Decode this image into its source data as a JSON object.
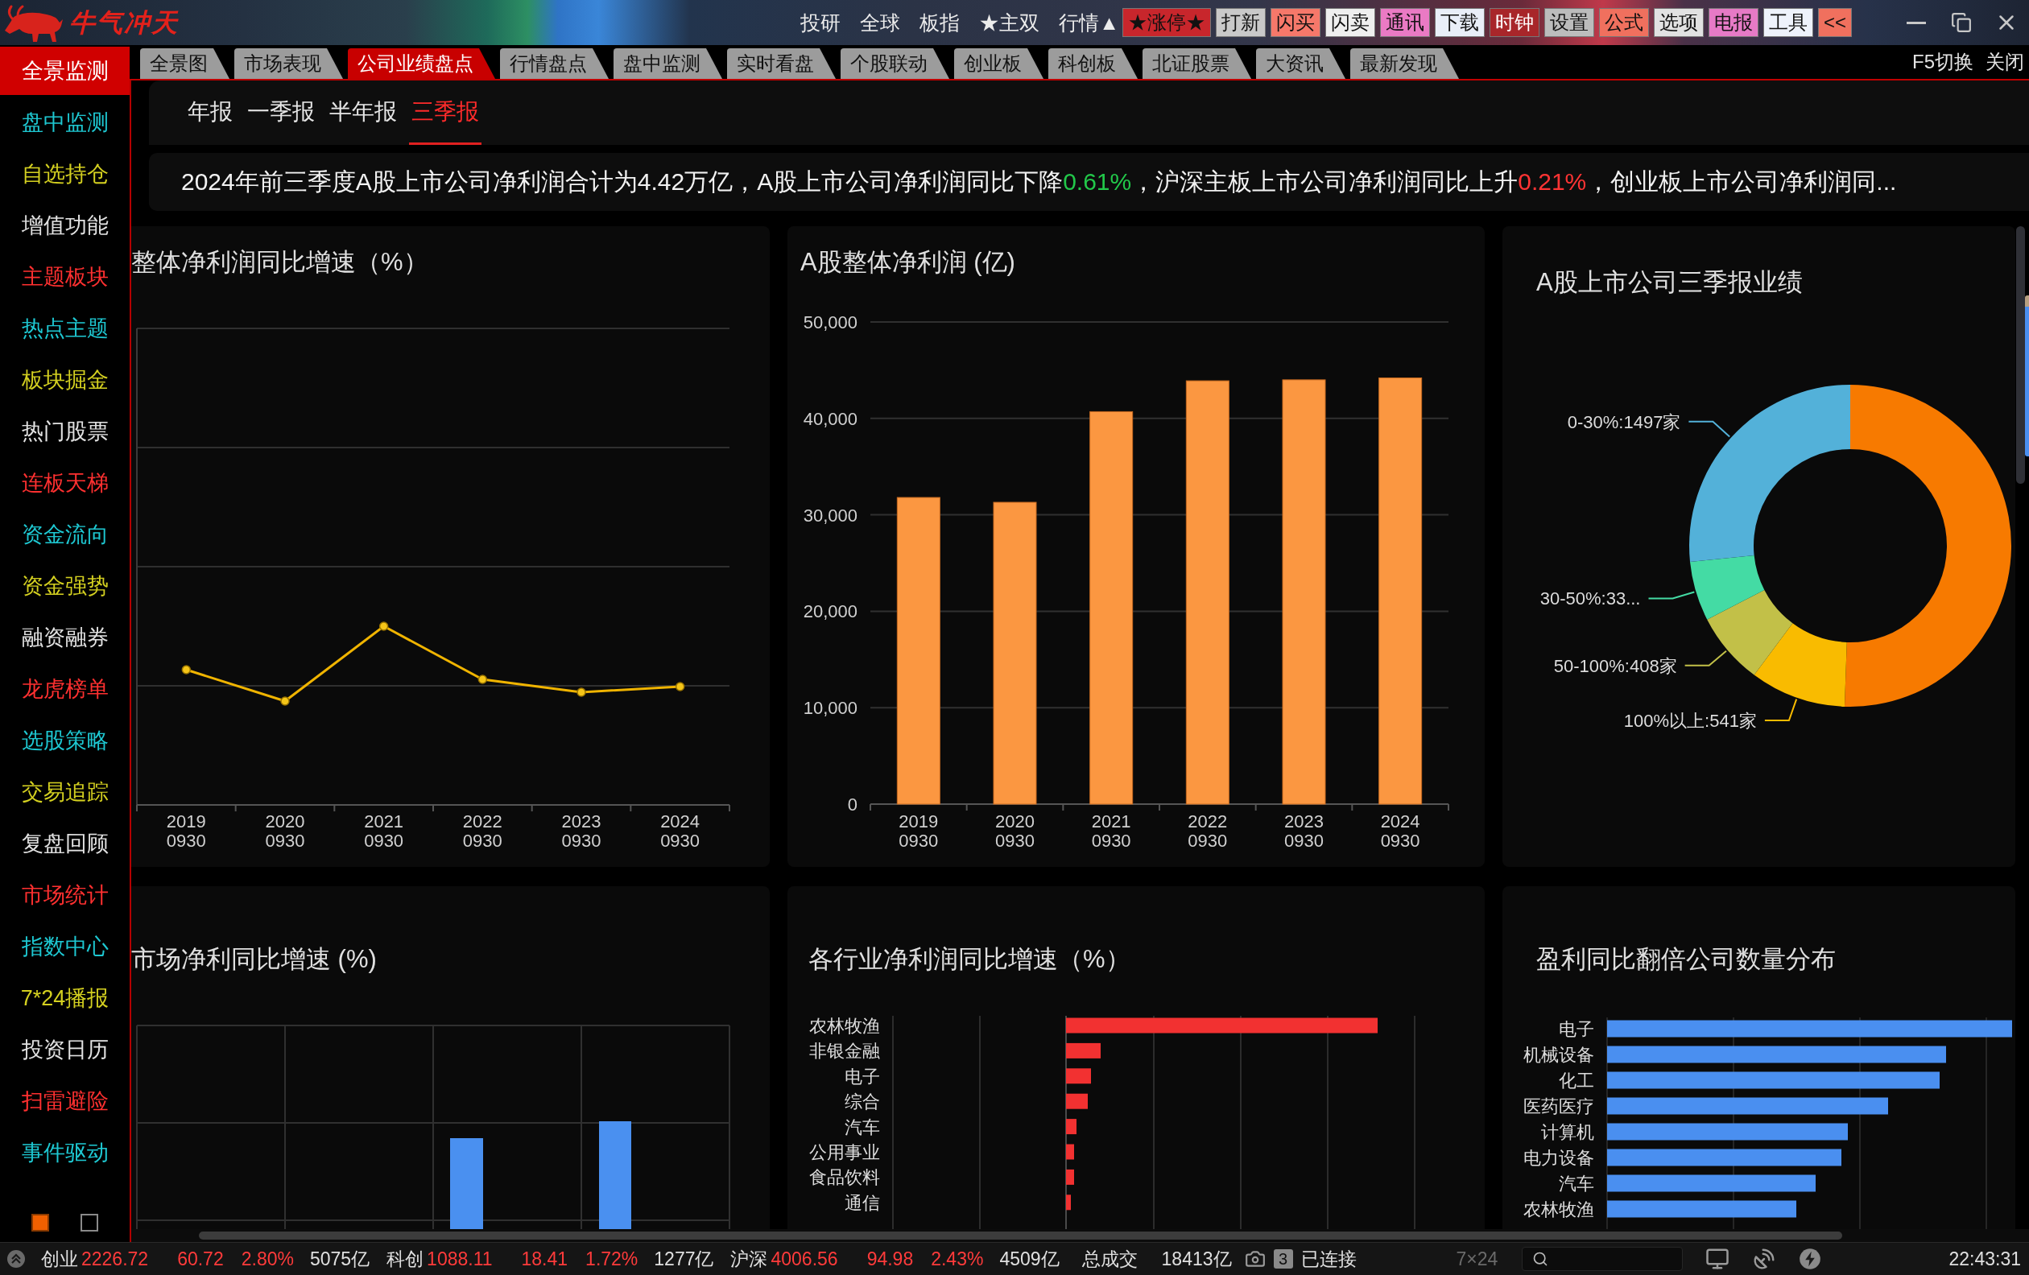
{
  "title_bar": {
    "logo_text": "牛气冲天",
    "menu": [
      "投研",
      "全球",
      "板指",
      "★主双",
      "行情▲"
    ],
    "buttons": [
      {
        "label": "★涨停★",
        "color": "#c8262c"
      },
      {
        "label": "打新",
        "color": "#c9c9c9"
      },
      {
        "label": "闪买",
        "color": "#f6786a"
      },
      {
        "label": "闪卖",
        "color": "#efefef"
      },
      {
        "label": "通讯",
        "color": "#ea7ac4"
      },
      {
        "label": "下载",
        "color": "#e9eef8"
      },
      {
        "label": "时钟",
        "color": "#a8262a"
      },
      {
        "label": "设置",
        "color": "#bcbcbc"
      },
      {
        "label": "公式",
        "color": "#f0705e"
      },
      {
        "label": "选项",
        "color": "#e2e2e2"
      },
      {
        "label": "电报",
        "color": "#e67ac6"
      },
      {
        "label": "工具",
        "color": "#eef2fb"
      },
      {
        "label": "<<",
        "color": "#f0705e"
      }
    ]
  },
  "tabs": [
    {
      "label": "全景图",
      "selected": false
    },
    {
      "label": "市场表现",
      "selected": false
    },
    {
      "label": "公司业绩盘点",
      "selected": true
    },
    {
      "label": "行情盘点",
      "selected": false
    },
    {
      "label": "盘中监测",
      "selected": false
    },
    {
      "label": "实时看盘",
      "selected": false
    },
    {
      "label": "个股联动",
      "selected": false
    },
    {
      "label": "创业板",
      "selected": false
    },
    {
      "label": "科创板",
      "selected": false
    },
    {
      "label": "北证股票",
      "selected": false
    },
    {
      "label": "大资讯",
      "selected": false
    },
    {
      "label": "最新发现",
      "selected": false
    }
  ],
  "tab_actions": [
    "F5切换",
    "关闭"
  ],
  "sidebar": {
    "items": [
      {
        "label": "全景监测",
        "selected": true,
        "color": "#d00000"
      },
      {
        "label": "盘中监测",
        "selected": false,
        "color": "#1ec8d2"
      },
      {
        "label": "自选持仓",
        "selected": false,
        "color": "#d4d020"
      },
      {
        "label": "增值功能",
        "selected": false,
        "color": "#e2e2e2"
      },
      {
        "label": "主题板块",
        "selected": false,
        "color": "#ff3030"
      },
      {
        "label": "热点主题",
        "selected": false,
        "color": "#1ec8d2"
      },
      {
        "label": "板块掘金",
        "selected": false,
        "color": "#d4d020"
      },
      {
        "label": "热门股票",
        "selected": false,
        "color": "#e2e2e2"
      },
      {
        "label": "连板天梯",
        "selected": false,
        "color": "#ff3030"
      },
      {
        "label": "资金流向",
        "selected": false,
        "color": "#1ec8d2"
      },
      {
        "label": "资金强势",
        "selected": false,
        "color": "#d4d020"
      },
      {
        "label": "融资融券",
        "selected": false,
        "color": "#e2e2e2"
      },
      {
        "label": "龙虎榜单",
        "selected": false,
        "color": "#ff3030"
      },
      {
        "label": "选股策略",
        "selected": false,
        "color": "#1ec8d2"
      },
      {
        "label": "交易追踪",
        "selected": false,
        "color": "#d4d020"
      },
      {
        "label": "复盘回顾",
        "selected": false,
        "color": "#e2e2e2"
      },
      {
        "label": "市场统计",
        "selected": false,
        "color": "#ff3030"
      },
      {
        "label": "指数中心",
        "selected": false,
        "color": "#1ec8d2"
      },
      {
        "label": "7*24播报",
        "selected": false,
        "color": "#d4d020"
      },
      {
        "label": "投资日历",
        "selected": false,
        "color": "#e2e2e2"
      },
      {
        "label": "扫雷避险",
        "selected": false,
        "color": "#ff3030"
      },
      {
        "label": "事件驱动",
        "selected": false,
        "color": "#1ec8d2"
      }
    ],
    "pages": [
      {
        "selected": true
      },
      {
        "selected": false
      }
    ]
  },
  "report_tabs": [
    {
      "label": "年报",
      "selected": false
    },
    {
      "label": "一季报",
      "selected": false
    },
    {
      "label": "半年报",
      "selected": false
    },
    {
      "label": "三季报",
      "selected": true
    }
  ],
  "summary": [
    {
      "text": "2024年前三季度A股上市公司净利润合计为4.42万亿，A股上市公司净利润同比下降",
      "kind": "plain"
    },
    {
      "text": "0.61%",
      "kind": "down"
    },
    {
      "text": "，沪深主板上市公司净利润同比上升",
      "kind": "plain"
    },
    {
      "text": "0.21%",
      "kind": "up"
    },
    {
      "text": "，创业板上市公司净利润同...",
      "kind": "plain"
    }
  ],
  "panels": {
    "profit_growth": {
      "title": "整体净利润同比增速（%）",
      "x_labels": [
        "2019 0930",
        "2020 0930",
        "2021 0930",
        "2022 0930",
        "2023 0930",
        "2024 0930"
      ]
    },
    "net_profit": {
      "chart_data": {
        "type": "bar",
        "title": "A股整体净利润 (亿)",
        "categories": [
          "2019 0930",
          "2020 0930",
          "2021 0930",
          "2022 0930",
          "2023 0930",
          "2024 0930"
        ],
        "values": [
          31800,
          31300,
          40700,
          43900,
          44000,
          44200
        ],
        "ylim": [
          0,
          50000
        ],
        "yticks": [
          {
            "value": 0,
            "label": "0"
          },
          {
            "value": 10000,
            "label": "10,000"
          },
          {
            "value": 20000,
            "label": "20,000"
          },
          {
            "value": 30000,
            "label": "30,000"
          },
          {
            "value": 40000,
            "label": "40,000"
          },
          {
            "value": 50000,
            "label": "50,000"
          }
        ],
        "grid": true
      }
    },
    "results": {
      "chart_data": {
        "type": "donut",
        "title": "A股上市公司三季报业绩",
        "categories": [
          null,
          "100%以上:541家",
          "50-100%:408家",
          "30-50%:33...",
          "0-30%:1497家"
        ],
        "values": [
          2845,
          541,
          408,
          336,
          1497
        ],
        "colors": [
          "#f77a00",
          "#f9bb00",
          "#c2c048",
          "#44dba4",
          "#53b1d9"
        ]
      }
    },
    "market_growth": {
      "title": "市场净利同比增速 (%)"
    },
    "industry_growth": {
      "title": "各行业净利润同比增速（%）",
      "categories": [
        "农林牧渔",
        "非银金融",
        "电子",
        "综合",
        "汽车",
        "公用事业",
        "食品饮料",
        "通信"
      ]
    },
    "doubling": {
      "title": "盈利同比翻倍公司数量分布",
      "categories": [
        "电子",
        "机械设备",
        "化工",
        "医药医疗",
        "计算机",
        "电力设备",
        "汽车",
        "农林牧渔"
      ]
    }
  },
  "status_bar": {
    "indices": [
      {
        "name": "创业",
        "value": "2226.72",
        "change": "60.72",
        "percent": "2.80%",
        "amount": "5075亿",
        "rising": true
      },
      {
        "name": "科创",
        "value": "1088.11",
        "change": "18.41",
        "percent": "1.72%",
        "amount": "1277亿",
        "rising": true
      },
      {
        "name": "沪深",
        "value": "4006.56",
        "change": "94.98",
        "percent": "2.43%",
        "amount": "4509亿",
        "rising": true
      }
    ],
    "total_label": "总成交",
    "total_value": "18413亿",
    "connection_count": "3",
    "connection_status": "已连接",
    "feed_label": "7×24",
    "clock": "22:43:31"
  }
}
